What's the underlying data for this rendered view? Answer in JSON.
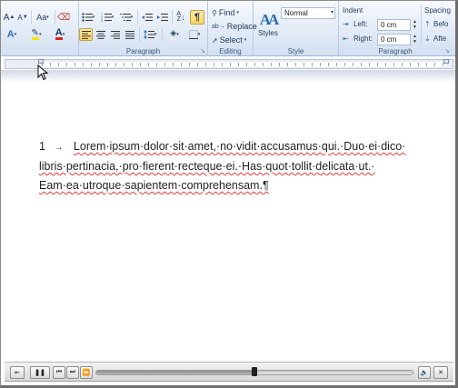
{
  "ribbon": {
    "font_group": {
      "grow_font_label": "A",
      "shrink_font_label": "A",
      "change_case_label": "Aa"
    },
    "paragraph_group": {
      "label": "Paragraph"
    },
    "editing_group": {
      "label": "Editing",
      "find_label": "Find",
      "replace_label": "Replace",
      "select_label": "Select"
    },
    "style_group": {
      "label": "Style",
      "styles_label": "Styles",
      "current_style": "Normal"
    },
    "indent_group": {
      "label": "Paragraph",
      "indent_title": "Indent",
      "left_label": "Left:",
      "left_value": "0 cm",
      "right_label": "Right:",
      "right_value": "0 cm",
      "spacing_title": "Spacing",
      "before_label": "Befo",
      "after_label": "Afte"
    }
  },
  "document": {
    "list_number": "1",
    "tab_mark": "→",
    "lines": [
      "Lorem·ipsum·dolor·sit·amet,·no·vidit·accusamus·qui.·Duo·ei·dico·",
      "libris·pertinacia,·pro·fierent·recteque·ei.·Has·quot·tollit·delicata·ut.·",
      "Eam·ea·utroque·sapientem·comprehensam.¶"
    ]
  },
  "player": {
    "progress": 0.5
  },
  "colors": {
    "ribbon_bg": "#dde7f4",
    "active_button": "#ffd35e",
    "spellcheck_underline": "#e23b3b"
  }
}
